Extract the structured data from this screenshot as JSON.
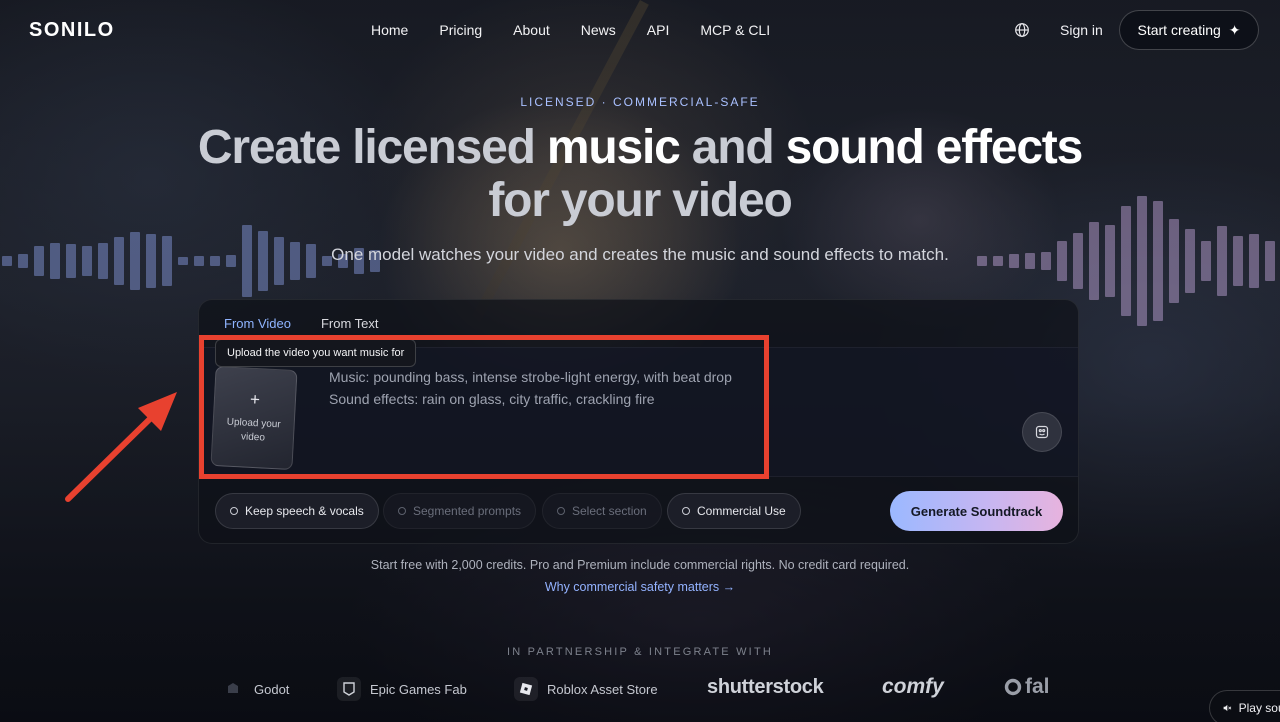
{
  "header": {
    "logo": "SONILO",
    "nav": [
      "Home",
      "Pricing",
      "About",
      "News",
      "API",
      "MCP & CLI"
    ],
    "globe_icon": "globe-icon",
    "sign_in": "Sign in",
    "start_creating": "Start creating",
    "sparkle_icon": "✦"
  },
  "hero": {
    "eyebrow": "LICENSED · COMMERCIAL-SAFE",
    "headline": {
      "part1": "Create licensed ",
      "part2": "music",
      "part3": " and ",
      "part4": "sound effects",
      "line2": "for your video"
    },
    "subtitle": "One model watches your video and creates the music and sound effects to match."
  },
  "composer": {
    "tabs": [
      "From Video",
      "From Text"
    ],
    "active_tab": "From Video",
    "tooltip": "Upload the video you want music for",
    "upload_plus": "+",
    "upload_label": "Upload your video",
    "prompt_placeholder": "Music: pounding bass, intense strobe-light energy, with beat drop\nSound effects: rain on glass, city traffic, crackling fire",
    "chips": [
      {
        "label": "Keep speech & vocals",
        "enabled": true
      },
      {
        "label": "Segmented prompts",
        "enabled": false
      },
      {
        "label": "Select section",
        "enabled": false
      },
      {
        "label": "Commercial Use",
        "enabled": true
      }
    ],
    "generate": "Generate Soundtrack"
  },
  "footer_note": {
    "text": "Start free with 2,000 credits. Pro and Premium include commercial rights. No credit card required.",
    "link": "Why commercial safety matters →"
  },
  "partners": {
    "title": "IN PARTNERSHIP & INTEGRATE WITH",
    "items": [
      "Godot",
      "Epic Games Fab",
      "Roblox Asset Store",
      "shutterstock",
      "comfy",
      "fal"
    ]
  },
  "play_sound": "Play sound",
  "colors": {
    "accent": "#8fb4ff",
    "highlight": "#e8412f",
    "gradient_start": "#9bb8ff",
    "gradient_end": "#e7b3de"
  }
}
